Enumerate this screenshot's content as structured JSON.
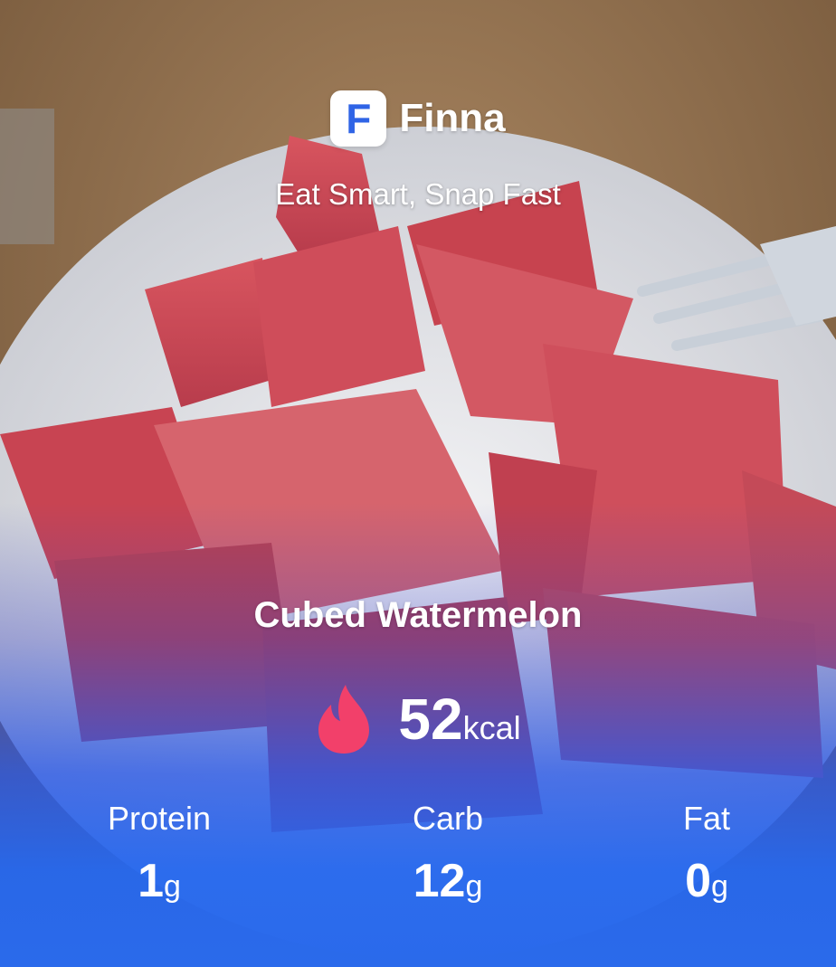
{
  "header": {
    "logo_letter": "F",
    "brand_name": "Finna",
    "tagline": "Eat Smart, Snap Fast"
  },
  "food": {
    "name": "Cubed Watermelon"
  },
  "calories": {
    "value": "52",
    "unit": "kcal"
  },
  "macros": {
    "protein": {
      "label": "Protein",
      "value": "1",
      "unit": "g"
    },
    "carb": {
      "label": "Carb",
      "value": "12",
      "unit": "g"
    },
    "fat": {
      "label": "Fat",
      "value": "0",
      "unit": "g"
    }
  },
  "colors": {
    "brand_blue": "#2f64e6",
    "flame": "#f2406a",
    "gradient_bottom": "#2a6aeb"
  },
  "icons": {
    "logo": "finna-logo-icon",
    "calories": "flame-icon"
  }
}
